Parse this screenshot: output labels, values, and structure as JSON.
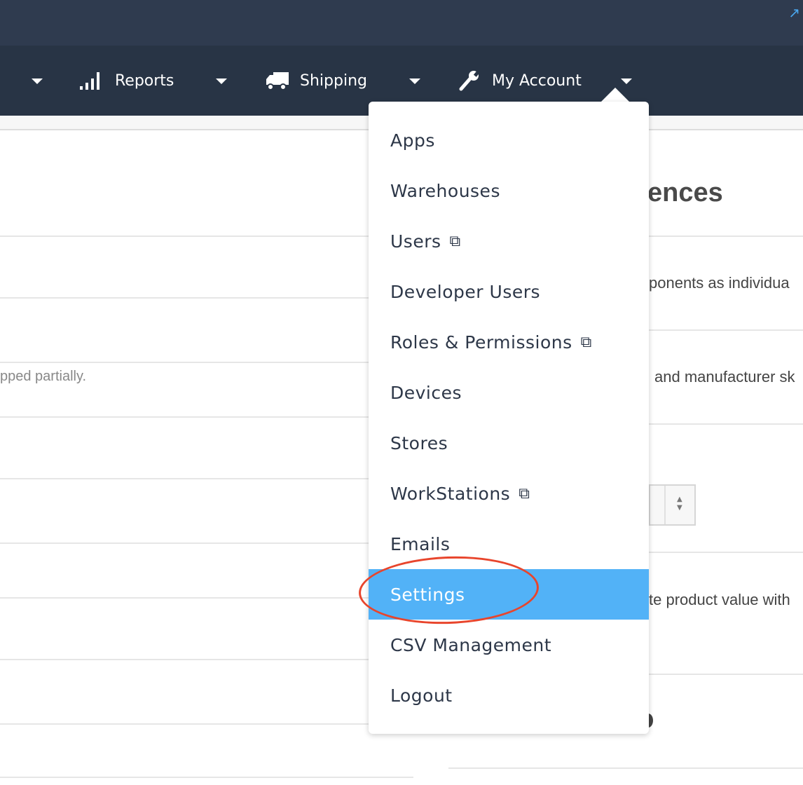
{
  "nav": {
    "reports": "Reports",
    "shipping": "Shipping",
    "my_account": "My Account"
  },
  "content": {
    "heading_fragment": "ences",
    "left_note": "pped partially.",
    "right_texts": [
      "ponents as individua",
      "and manufacturer sk",
      "te product value with"
    ]
  },
  "menu": {
    "items": [
      {
        "label": "Apps",
        "external": false
      },
      {
        "label": "Warehouses",
        "external": false
      },
      {
        "label": "Users",
        "external": true
      },
      {
        "label": "Developer Users",
        "external": false
      },
      {
        "label": "Roles & Permissions",
        "external": true
      },
      {
        "label": "Devices",
        "external": false
      },
      {
        "label": "Stores",
        "external": false
      },
      {
        "label": "WorkStations",
        "external": true
      },
      {
        "label": "Emails",
        "external": false
      },
      {
        "label": "Settings",
        "external": false,
        "active": true
      },
      {
        "label": "CSV Management",
        "external": false
      },
      {
        "label": "Logout",
        "external": false
      }
    ]
  },
  "colors": {
    "topbar": "#2f3b4f",
    "navbar": "#283445",
    "active": "#52b2f7",
    "highlight_circle": "#e8452c"
  }
}
